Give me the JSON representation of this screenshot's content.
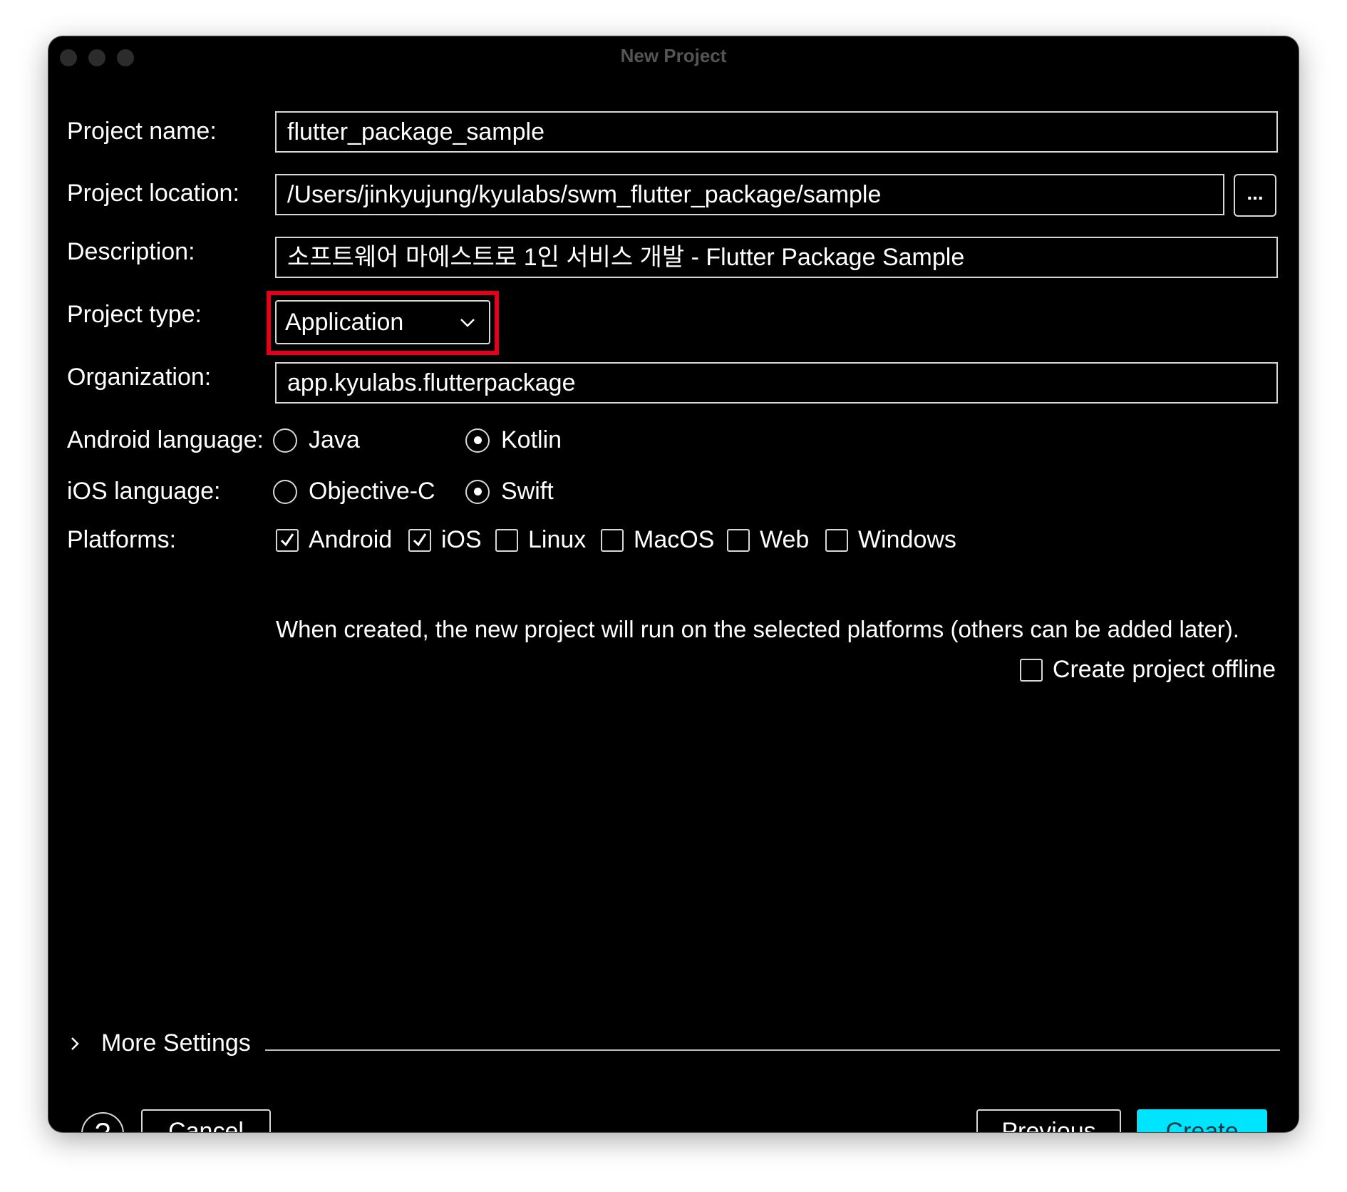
{
  "window": {
    "title": "New Project"
  },
  "form": {
    "project_name_label": "Project name:",
    "project_name_value": "flutter_package_sample",
    "project_location_label": "Project location:",
    "project_location_value": "/Users/jinkyujung/kyulabs/swm_flutter_package/sample",
    "browse_label": "...",
    "description_label": "Description:",
    "description_value": "소프트웨어 마에스트로 1인 서비스 개발 - Flutter Package Sample",
    "project_type_label": "Project type:",
    "project_type_value": "Application",
    "organization_label": "Organization:",
    "organization_value": "app.kyulabs.flutterpackage",
    "android_language_label": "Android language:",
    "android_options": [
      {
        "label": "Java",
        "selected": false
      },
      {
        "label": "Kotlin",
        "selected": true
      }
    ],
    "ios_language_label": "iOS language:",
    "ios_options": [
      {
        "label": "Objective-C",
        "selected": false
      },
      {
        "label": "Swift",
        "selected": true
      }
    ],
    "platforms_label": "Platforms:",
    "platforms": [
      {
        "label": "Android",
        "checked": true
      },
      {
        "label": "iOS",
        "checked": true
      },
      {
        "label": "Linux",
        "checked": false
      },
      {
        "label": "MacOS",
        "checked": false
      },
      {
        "label": "Web",
        "checked": false
      },
      {
        "label": "Windows",
        "checked": false
      }
    ],
    "platforms_hint": "When created, the new project will run on the selected platforms (others can be added later).",
    "offline_label": "Create project offline",
    "offline_checked": false
  },
  "more_settings": {
    "label": "More Settings"
  },
  "footer": {
    "help_label": "?",
    "cancel_label": "Cancel",
    "previous_label": "Previous",
    "create_label": "Create"
  },
  "colors": {
    "background": "#000000",
    "accent": "#00e5ff",
    "highlight_box": "#e4001b"
  },
  "icons": {
    "dropdown": "chevron-down-icon",
    "more_settings": "chevron-right-icon",
    "help": "question-mark-icon"
  }
}
